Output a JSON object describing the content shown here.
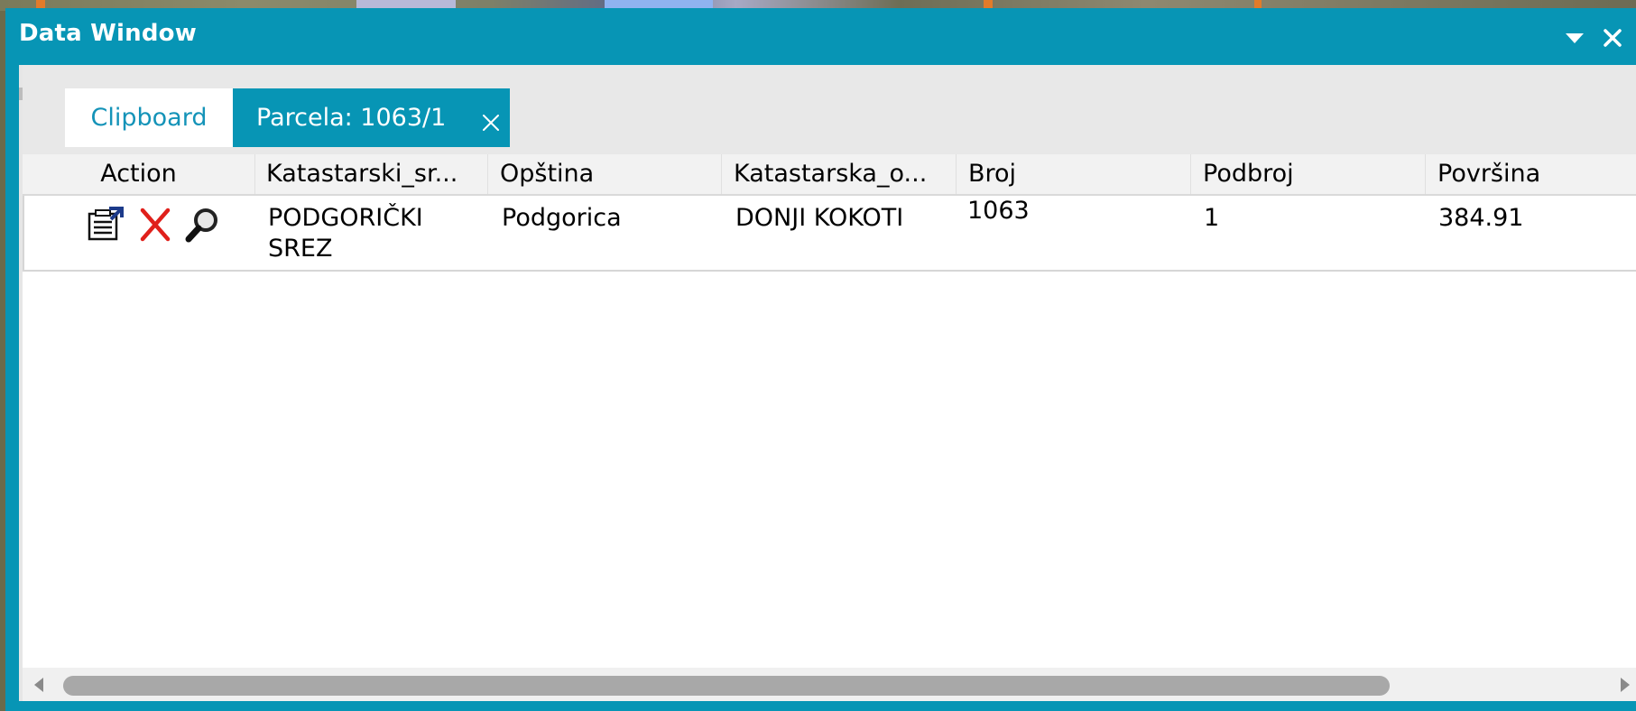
{
  "window": {
    "title": "Data Window",
    "collapse_icon": "triangle-down-icon",
    "close_icon": "close-icon"
  },
  "tabs": [
    {
      "label": "Clipboard",
      "active": false
    },
    {
      "label": "Parcela: 1063/1",
      "active": true,
      "closable": true
    }
  ],
  "grid": {
    "columns": [
      "Action",
      "Katastarski_sr...",
      "Opština",
      "Katastarska_o...",
      "Broj",
      "Podbroj",
      "Površina"
    ],
    "rows": [
      {
        "actions": [
          "properties-icon",
          "delete-icon",
          "zoom-icon"
        ],
        "katastarski_srez": "PODGORIČKI SREZ",
        "opstina": "Podgorica",
        "katastarska_opstina": "DONJI KOKOTI",
        "broj": "1063",
        "podbroj": "1",
        "povrsina": "384.91"
      }
    ]
  },
  "colors": {
    "accent": "#0795b5",
    "tab_inactive_text": "#1493b8",
    "delete_red": "#e0201b"
  }
}
